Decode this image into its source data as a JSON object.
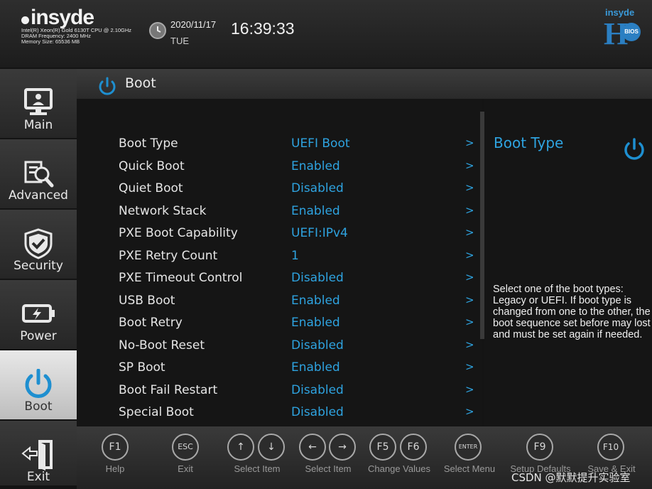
{
  "header": {
    "logo_text": "insyde",
    "cpu": "Intel(R) Xeon(R) Gold 6130T CPU @ 2.10GHz",
    "dram": "DRAM Frequency: 2400 MHz",
    "memory": "Memory Size: 65536 MB",
    "date": "2020/11/17",
    "day": "TUE",
    "time": "16:39:33",
    "brand_top": "insyde",
    "brand_h": "H",
    "brand_badge": "BIOS"
  },
  "sidebar": {
    "items": [
      {
        "label": "Main",
        "icon": "monitor-icon"
      },
      {
        "label": "Advanced",
        "icon": "magnifier-gear-icon"
      },
      {
        "label": "Security",
        "icon": "shield-check-icon"
      },
      {
        "label": "Power",
        "icon": "battery-icon"
      },
      {
        "label": "Boot",
        "icon": "power-icon",
        "active": true
      },
      {
        "label": "Exit",
        "icon": "exit-door-icon"
      }
    ]
  },
  "page": {
    "title": "Boot"
  },
  "settings": [
    {
      "name": "Boot Type",
      "value": "UEFI Boot",
      "arrow": ">"
    },
    {
      "name": "Quick Boot",
      "value": "Enabled",
      "arrow": ">"
    },
    {
      "name": "Quiet Boot",
      "value": "Disabled",
      "arrow": ">"
    },
    {
      "name": "Network Stack",
      "value": "Enabled",
      "arrow": ">"
    },
    {
      "name": "PXE Boot Capability",
      "value": "UEFI:IPv4",
      "arrow": ">"
    },
    {
      "name": "PXE Retry Count",
      "value": "1",
      "arrow": ">"
    },
    {
      "name": "PXE Timeout Control",
      "value": "Disabled",
      "arrow": ">"
    },
    {
      "name": "USB Boot",
      "value": "Enabled",
      "arrow": ">"
    },
    {
      "name": "Boot Retry",
      "value": "Enabled",
      "arrow": ">"
    },
    {
      "name": "No-Boot Reset",
      "value": "Disabled",
      "arrow": ">"
    },
    {
      "name": "SP Boot",
      "value": "Enabled",
      "arrow": ">"
    },
    {
      "name": "Boot Fail Restart",
      "value": "Disabled",
      "arrow": ">"
    },
    {
      "name": "Special Boot",
      "value": "Disabled",
      "arrow": ">"
    }
  ],
  "help": {
    "title": "Boot Type",
    "description": "Select one of the boot types: Legacy or UEFI. If boot type is changed from one to the other, the boot sequence set before may lost and must be set again if needed."
  },
  "footer": {
    "keys": [
      {
        "key": "F1",
        "label": "Help"
      },
      {
        "key": "ESC",
        "label": "Exit"
      },
      {
        "key": "↑",
        "label": "Select Item"
      },
      {
        "key": "↓",
        "label": ""
      },
      {
        "key": "←",
        "label": "Select Item"
      },
      {
        "key": "→",
        "label": ""
      },
      {
        "key": "F5",
        "label": "Change Values"
      },
      {
        "key": "F6",
        "label": ""
      },
      {
        "key": "ENTER",
        "label": "Select Menu"
      },
      {
        "key": "F9",
        "label": "Setup Defaults"
      },
      {
        "key": "F10",
        "label": "Save & Exit"
      }
    ]
  },
  "watermark": "CSDN @默默提升实验室",
  "colors": {
    "accent": "#2ea3e0",
    "background": "#151515",
    "active_tab": "#d6d6d6"
  }
}
